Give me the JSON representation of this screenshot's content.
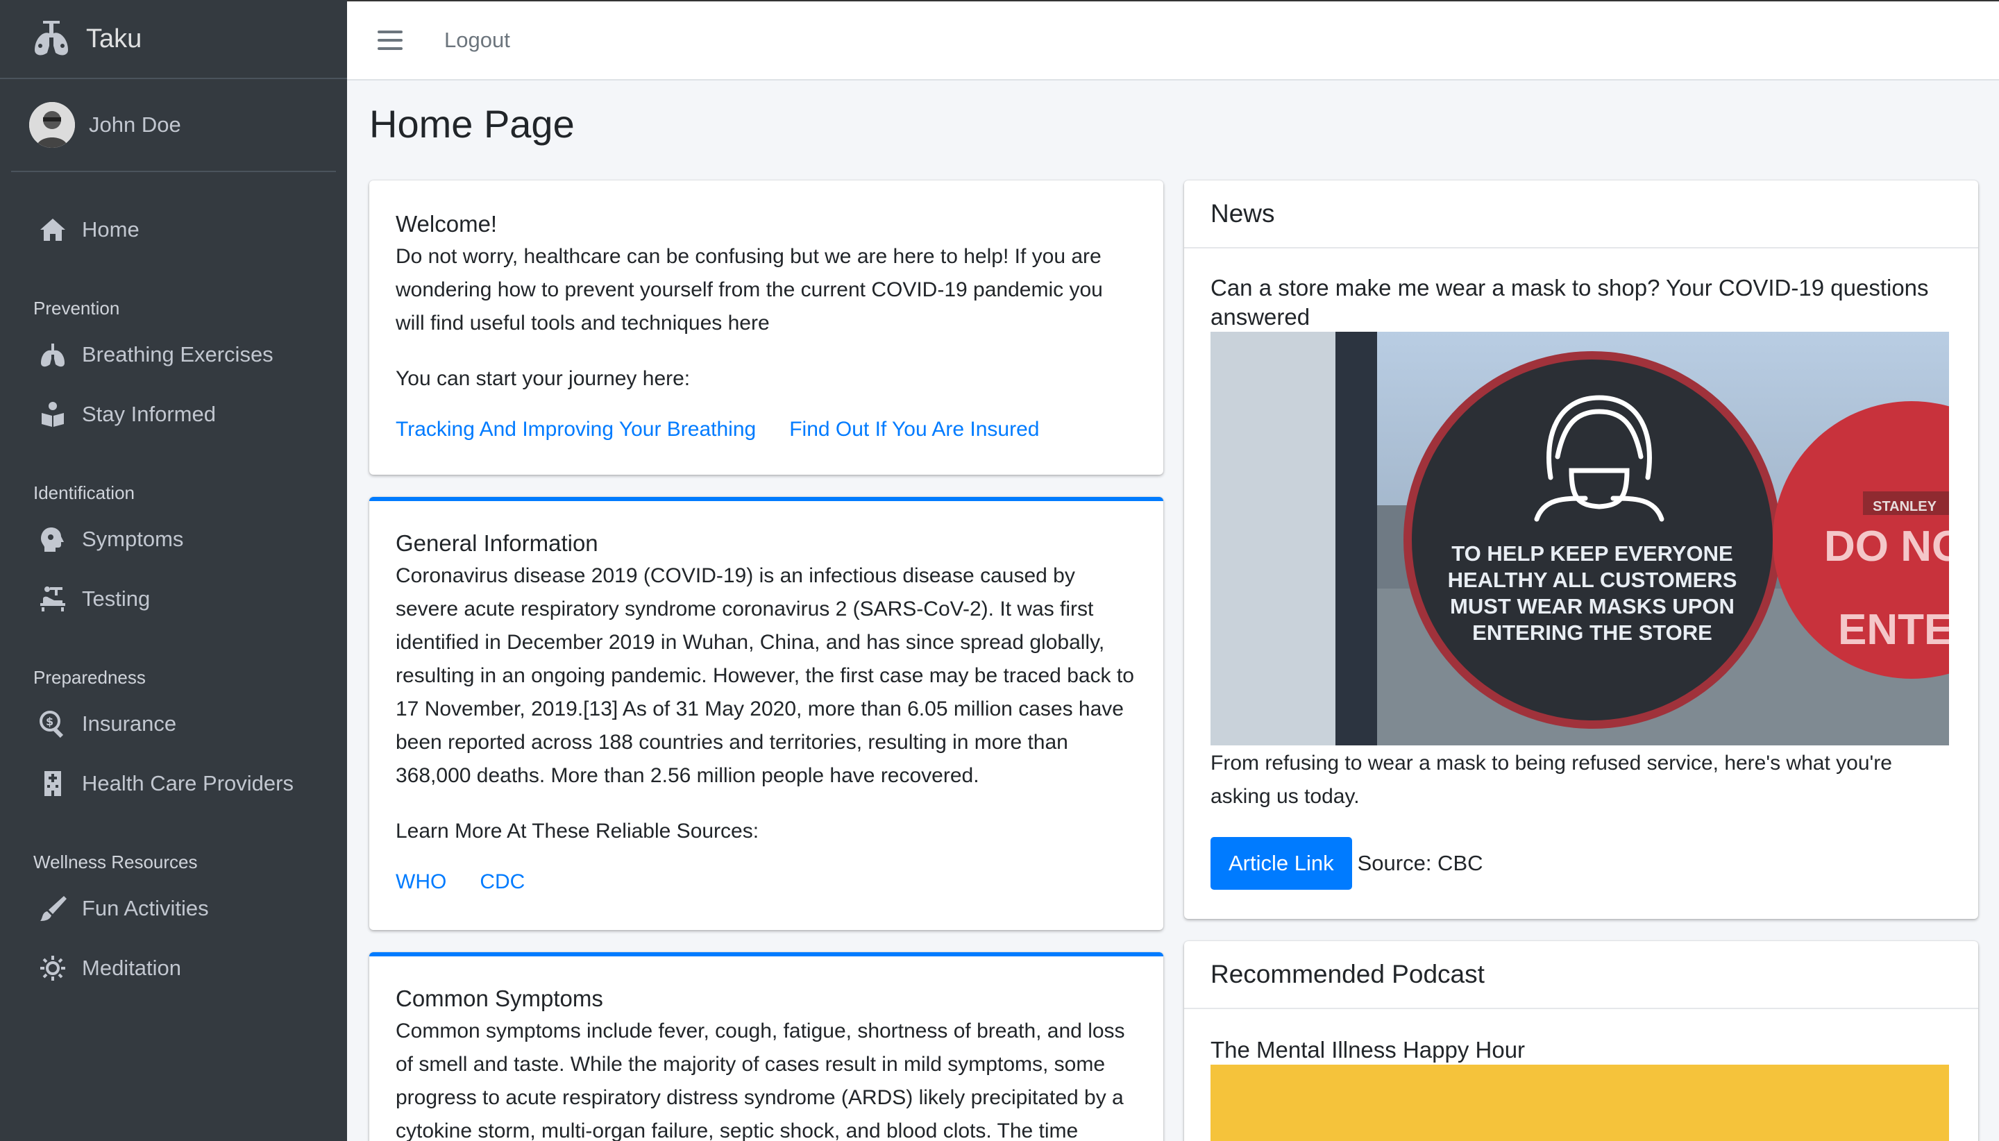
{
  "app": {
    "brand": "Taku",
    "user": "John Doe"
  },
  "sidebar": {
    "home": "Home",
    "sections": [
      {
        "header": "Prevention",
        "items": [
          "Breathing Exercises",
          "Stay Informed"
        ]
      },
      {
        "header": "Identification",
        "items": [
          "Symptoms",
          "Testing"
        ]
      },
      {
        "header": "Preparedness",
        "items": [
          "Insurance",
          "Health Care Providers"
        ]
      },
      {
        "header": "Wellness Resources",
        "items": [
          "Fun Activities",
          "Meditation"
        ]
      }
    ]
  },
  "topbar": {
    "logout": "Logout"
  },
  "page": {
    "title": "Home Page"
  },
  "welcome": {
    "title": "Welcome!",
    "text": "Do not worry, healthcare can be confusing but we are here to help! If you are wondering how to prevent yourself from the current COVID-19 pandemic you will find useful tools and techniques here",
    "start": "You can start your journey here:",
    "links": [
      "Tracking And Improving Your Breathing",
      "Find Out If You Are Insured"
    ]
  },
  "general": {
    "title": "General Information",
    "text": "Coronavirus disease 2019 (COVID-19) is an infectious disease caused by severe acute respiratory syndrome coronavirus 2 (SARS-CoV-2). It was first identified in December 2019 in Wuhan, China, and has since spread globally, resulting in an ongoing pandemic. However, the first case may be traced back to 17 November, 2019.[13] As of 31 May 2020, more than 6.05 million cases have been reported across 188 countries and territories, resulting in more than 368,000 deaths. More than 2.56 million people have recovered.",
    "sources_label": "Learn More At These Reliable Sources:",
    "links": [
      "WHO",
      "CDC"
    ]
  },
  "symptoms": {
    "title": "Common Symptoms",
    "text": "Common symptoms include fever, cough, fatigue, shortness of breath, and loss of smell and taste. While the majority of cases result in mild symptoms, some progress to acute respiratory distress syndrome (ARDS) likely precipitated by a cytokine storm, multi-organ failure, septic shock, and blood clots. The time"
  },
  "news": {
    "header": "News",
    "title": "Can a store make me wear a mask to shop? Your COVID-19 questions answered",
    "sign_lines": [
      "TO HELP KEEP EVERYONE",
      "HEALTHY ALL CUSTOMERS",
      "MUST WEAR MASKS UPON",
      "ENTERING THE STORE"
    ],
    "sign_right": [
      "DO NO",
      "ENTE"
    ],
    "sign_brand": "STANLEY",
    "summary": "From refusing to wear a mask to being refused service, here's what you're asking us today.",
    "button": "Article Link",
    "source": "Source: CBC"
  },
  "podcast": {
    "header": "Recommended Podcast",
    "title": "The Mental Illness Happy Hour"
  },
  "colors": {
    "sidebar": "#343a40",
    "accent": "#007bff",
    "podcast_banner": "#f5c33b"
  }
}
